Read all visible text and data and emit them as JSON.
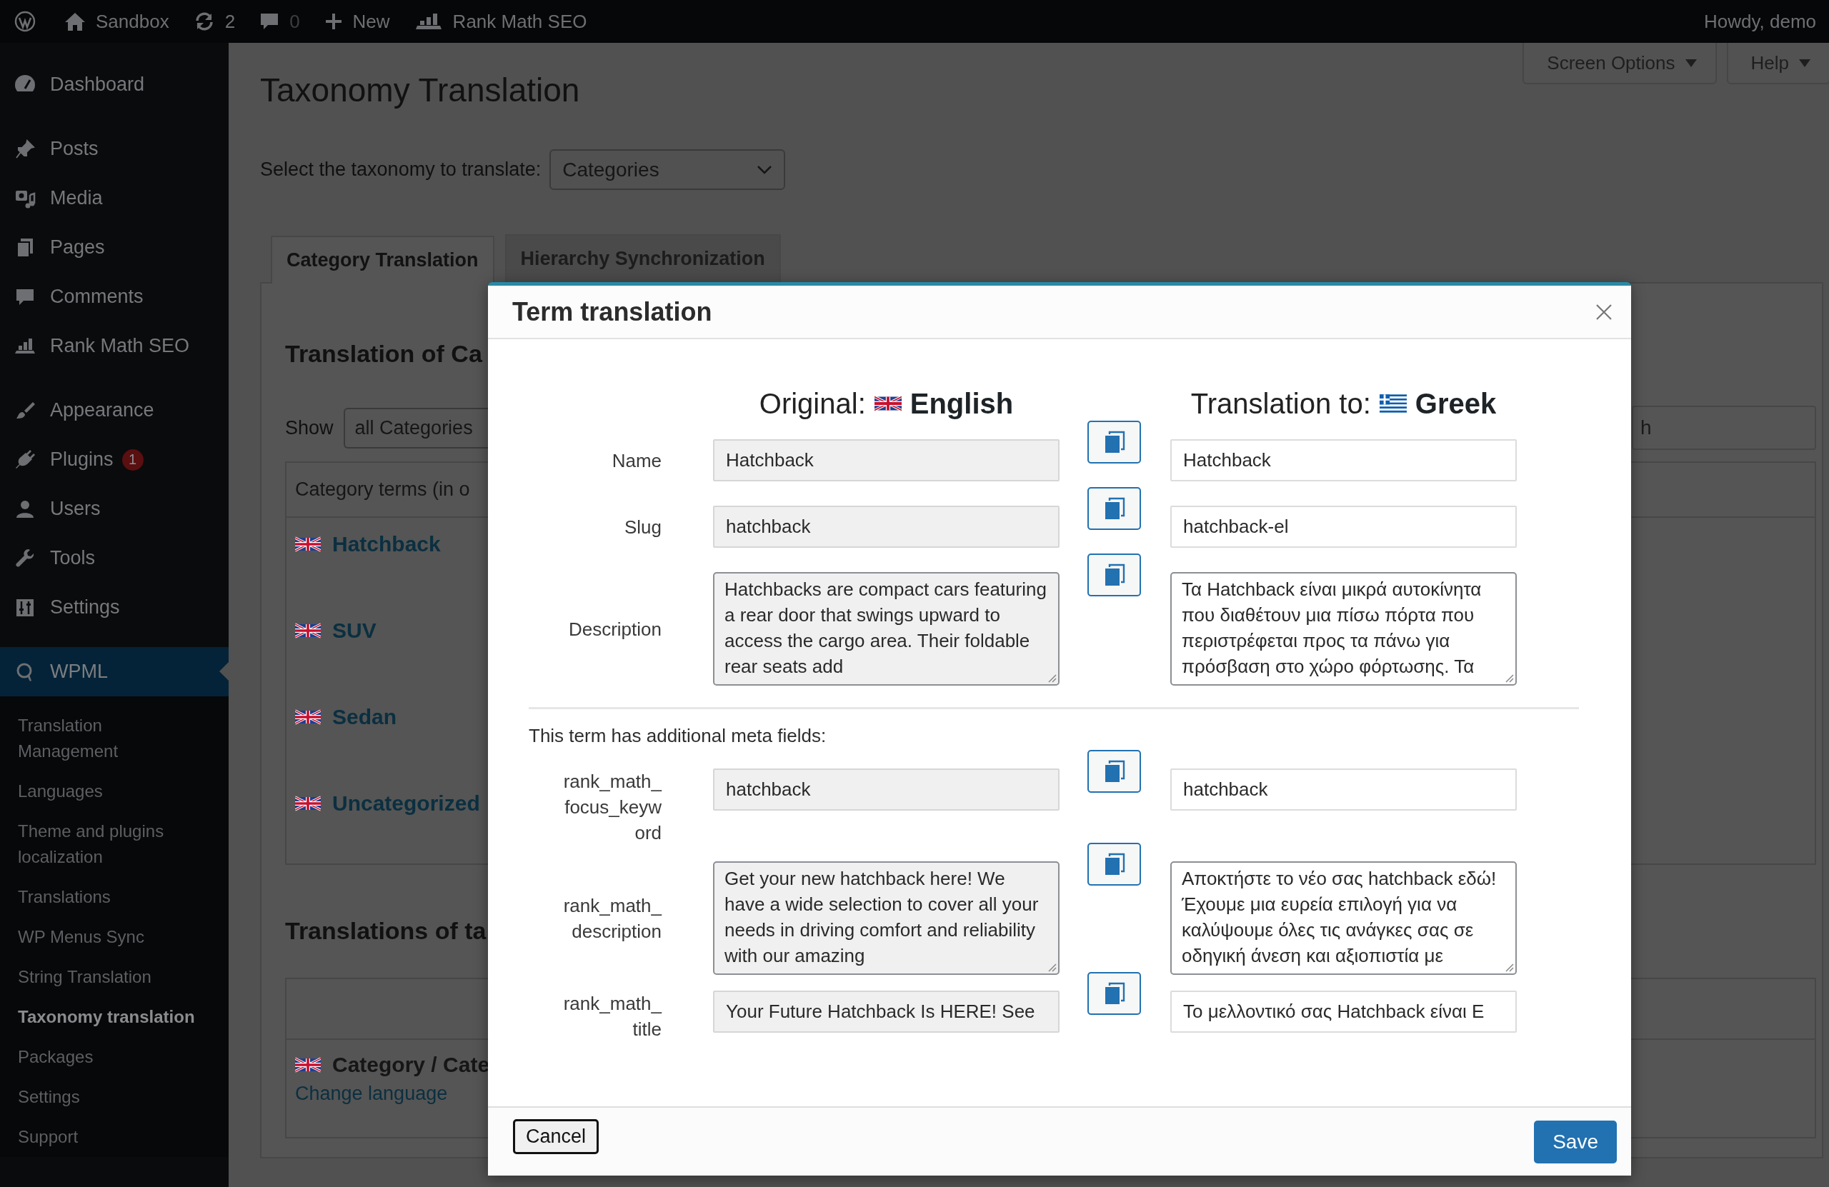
{
  "admin_bar": {
    "items": [
      {
        "kind": "logo"
      },
      {
        "kind": "site",
        "label": "Sandbox"
      },
      {
        "kind": "updates",
        "label": "2"
      },
      {
        "kind": "comments",
        "label": "0"
      },
      {
        "kind": "new",
        "label": "New"
      },
      {
        "kind": "seo",
        "label": "Rank Math SEO"
      }
    ],
    "account": "Howdy, demo"
  },
  "sidebar": {
    "groups": [
      [
        {
          "label": "Dashboard",
          "selected": false
        }
      ],
      [
        {
          "label": "Posts",
          "selected": false
        },
        {
          "label": "Media",
          "selected": false
        },
        {
          "label": "Pages",
          "selected": false
        },
        {
          "label": "Comments",
          "selected": false
        },
        {
          "label": "Rank Math SEO",
          "selected": false
        }
      ],
      [
        {
          "label": "Appearance",
          "selected": false
        },
        {
          "label": "Plugins",
          "selected": false,
          "badge": "1"
        },
        {
          "label": "Users",
          "selected": false
        },
        {
          "label": "Tools",
          "selected": false
        },
        {
          "label": "Settings",
          "selected": false
        }
      ],
      [
        {
          "label": "WPML",
          "selected": true,
          "submenu": [
            {
              "label": "Translation Management",
              "selected": false
            },
            {
              "label": "Languages",
              "selected": false
            },
            {
              "label": "Theme and plugins localization",
              "selected": false
            },
            {
              "label": "Translations",
              "selected": false
            },
            {
              "label": "WP Menus Sync",
              "selected": false
            },
            {
              "label": "String Translation",
              "selected": false
            },
            {
              "label": "Taxonomy translation",
              "selected": true
            },
            {
              "label": "Packages",
              "selected": false
            },
            {
              "label": "Settings",
              "selected": false
            },
            {
              "label": "Support",
              "selected": false
            }
          ]
        }
      ]
    ]
  },
  "screen_meta": [
    "Screen Options",
    "Help"
  ],
  "page": {
    "title": "Taxonomy Translation",
    "taxonomy_label": "Select the taxonomy to translate:",
    "taxonomy_select": "Categories",
    "tabs": [
      {
        "label": "Category Translation",
        "selected": true
      },
      {
        "label": "Hierarchy Synchronization",
        "selected": false
      }
    ],
    "heading": "Translation of Ca",
    "show_label": "Show",
    "show_select": "all Categories",
    "search_placeholder": "h",
    "table": {
      "column_1": "Category terms (in o",
      "rows": [
        {
          "name": "Hatchback"
        },
        {
          "name": "SUV"
        },
        {
          "name": "Sedan"
        },
        {
          "name": "Uncategorized"
        }
      ]
    },
    "heading_2": "Translations of ta",
    "table_2": {
      "rows": [
        {
          "name": "Category / Cate",
          "link": "Change language"
        }
      ]
    }
  },
  "modal": {
    "title": "Term translation",
    "original": {
      "prefix": "Original:",
      "language": "English"
    },
    "translation": {
      "prefix": "Translation to:",
      "language": "Greek"
    },
    "fields": [
      {
        "label": "Name",
        "kind": "input",
        "original": "Hatchback",
        "translation": "Hatchback"
      },
      {
        "label": "Slug",
        "kind": "input",
        "original": "hatchback",
        "translation": "hatchback-el"
      },
      {
        "label": "Description",
        "kind": "textarea",
        "original": "Hatchbacks are compact cars featuring a rear door that swings upward to access the cargo area. Their foldable rear seats add",
        "translation": "Τα Hatchback είναι μικρά αυτοκίνητα που διαθέτουν μια πίσω πόρτα που περιστρέφεται προς τα πάνω για πρόσβαση στο χώρο φόρτωσης. Τα"
      }
    ],
    "meta_note": "This term has additional meta fields:",
    "meta_fields": [
      {
        "label": "rank_math_focus_keyword",
        "kind": "input",
        "original": "hatchback",
        "translation": "hatchback"
      },
      {
        "label": "rank_math_description",
        "kind": "textarea",
        "original": "Get your new hatchback here! We have a wide selection to cover all your needs in driving comfort and reliability with our amazing",
        "translation": "Αποκτήστε το νέο σας hatchback εδώ! Έχουμε μια ευρεία επιλογή για να καλύψουμε όλες τις ανάγκες σας σε οδηγική άνεση και αξιοπιστία με"
      },
      {
        "label": "rank_math_title",
        "kind": "input",
        "original": "Your Future Hatchback Is HERE! See",
        "translation": "Το μελλοντικό σας Hatchback είναι Ε"
      }
    ],
    "cancel": "Cancel",
    "save": "Save"
  }
}
